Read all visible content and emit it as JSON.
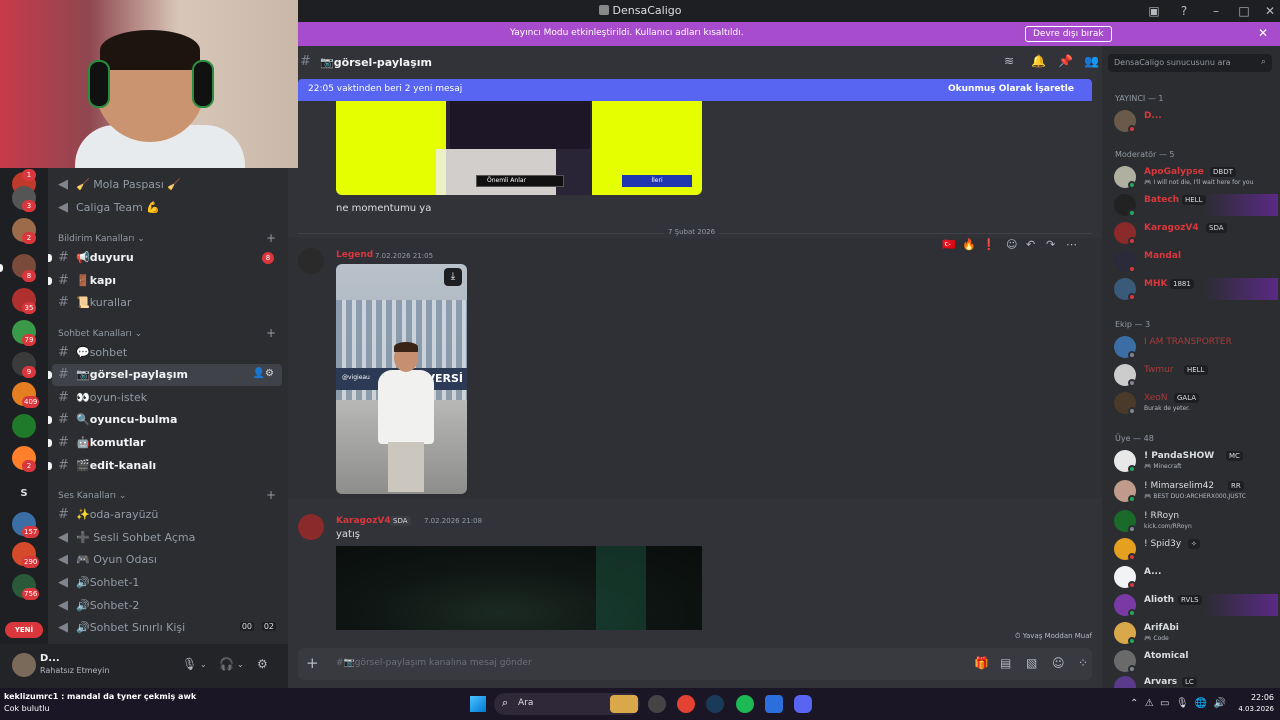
{
  "window": {
    "title": "DensaCaligo"
  },
  "banner": {
    "text": "Yayıncı Modu etkinleştirildi. Kullanıcı adları kısaltıldı.",
    "button": "Devre dışı bırak"
  },
  "server_rail": {
    "badges": [
      "1",
      "3",
      "2",
      "8",
      "35",
      "79",
      "9",
      "409",
      "2",
      "157",
      "290",
      "756"
    ],
    "server_letter": "S",
    "new_label": "YENİ",
    "colors": [
      "#c0392b",
      "#555555",
      "#9b6b4a",
      "#7a4a3a",
      "#b03030",
      "#3a9a4a",
      "#3b3b3b",
      "#e57e20",
      "#1f7a2a",
      "#ff7f2a",
      "#3a6ea5",
      "#d44a2a",
      "#2a5a3a",
      "#8a2a2a",
      "#d9a84a"
    ]
  },
  "channels": {
    "top": [
      {
        "name": "🧹 Mola Paspası 🧹",
        "icon": "speaker-icon"
      },
      {
        "name": "Caliga Team 💪",
        "icon": "speaker-icon"
      }
    ],
    "categories": [
      {
        "label": "Bildirim Kanalları"
      },
      {
        "label": "Sohbet Kanalları"
      },
      {
        "label": "Ses Kanalları"
      }
    ],
    "announce": [
      {
        "name": "📢duyuru",
        "badge": "8"
      },
      {
        "name": "🚪kapı"
      },
      {
        "name": "📜kurallar"
      }
    ],
    "chat": [
      {
        "name": "💬sohbet"
      },
      {
        "name": "📷görsel-paylaşım"
      },
      {
        "name": "👀oyun-istek"
      },
      {
        "name": "🔍oyuncu-bulma"
      },
      {
        "name": "🤖komutlar"
      },
      {
        "name": "🎬edit-kanalı"
      }
    ],
    "voice": [
      {
        "name": "✨oda-arayüzü"
      },
      {
        "name": "➕ Sesli Sohbet Açma"
      },
      {
        "name": "🎮 Oyun Odası"
      },
      {
        "name": "🔊Sohbet-1"
      },
      {
        "name": "🔊Sohbet-2"
      },
      {
        "name": "🔊Sohbet Sınırlı Kişi",
        "tag1": "00",
        "tag2": "02"
      }
    ]
  },
  "user_panel": {
    "name": "D...",
    "status": "Rahatsız Etmeyin"
  },
  "chat": {
    "channel": "📷görsel-paylaşım",
    "new_messages": "22:05 vaktinden beri 2 yeni mesaj",
    "mark_read": "Okunmuş Olarak İşaretle",
    "msg1": "ne momentumu ya",
    "date_divider": "7 Şubat 2026",
    "post2": {
      "author": "Legend",
      "timestamp": "7.02.2026 21:05",
      "author_color": "#da373c",
      "sign_text": "VERSİ",
      "watermark": "@vigieau"
    },
    "post3": {
      "author": "KaragozV4",
      "tag": "SDA",
      "timestamp": "7.02.2026 21:08",
      "text": "yatış",
      "author_color": "#da373c"
    },
    "img1": {
      "btn1": "Önemli Anlar",
      "btn2": "İleri"
    },
    "slow_mode": "Yavaş Moddan Muaf",
    "composer_placeholder": "#📷görsel-paylaşım kanalına mesaj gönder",
    "search_placeholder": "DensaCaligo sunucusunu ara"
  },
  "members": {
    "groups": [
      {
        "label": "YAYINCI — 1"
      },
      {
        "label": "Moderatör — 5"
      },
      {
        "label": "Ekip — 3"
      },
      {
        "label": "Üye — 48"
      }
    ],
    "list": [
      {
        "name": "D...",
        "color": "#da373c",
        "status": "#da373c",
        "avatar": "#6a5a4a"
      },
      {
        "name": "ApoGalypse",
        "tag": "DBDT",
        "sub": "🎮 I will not die, I'll wait here for you",
        "color": "#da373c",
        "status": "#23a55a",
        "avatar": "#b0b0a0"
      },
      {
        "name": "Batech",
        "tag": "HELL",
        "color": "#da373c",
        "status": "#23a55a",
        "avatar": "#222222"
      },
      {
        "name": "KaragozV4",
        "tag": "SDA",
        "color": "#da373c",
        "status": "#da373c",
        "avatar": "#8a2a2a"
      },
      {
        "name": "Mandal",
        "color": "#da373c",
        "status": "#da373c",
        "avatar": "#2a2a3a"
      },
      {
        "name": "MHK",
        "tag": "1881",
        "color": "#da373c",
        "status": "#da373c",
        "avatar": "#3a5a7a"
      },
      {
        "name": "I AM TRANSPORTER",
        "color": "#a83a3a",
        "status": "#80848e",
        "avatar": "#3a6ea5"
      },
      {
        "name": "Twmur",
        "tag": "HELL",
        "color": "#a83a3a",
        "status": "#80848e",
        "avatar": "#cccccc"
      },
      {
        "name": "XeoN",
        "tag": "GALA",
        "sub": "Burak de yeter.",
        "color": "#a83a3a",
        "status": "#80848e",
        "avatar": "#4a3a2a"
      },
      {
        "name": "! PandaSHOW",
        "tag": "MC",
        "sub": "🎮 Minecraft",
        "color": "#dbdee1",
        "status": "#23a55a",
        "avatar": "#e8e8e8"
      },
      {
        "name": "! Mimarselim42",
        "tag": "RR",
        "sub": "🎮 BEST DUO:ARCHERX000,JUSTC",
        "color": "#dbdee1",
        "status": "#23a55a",
        "avatar": "#c09a8a"
      },
      {
        "name": "! RRoyn",
        "sub": "kick.com/RRoyn",
        "color": "#dbdee1",
        "status": "#80848e",
        "avatar": "#1a6a2a"
      },
      {
        "name": "! Spid3y",
        "tag": "✧",
        "color": "#dbdee1",
        "status": "#da373c",
        "avatar": "#e5a020"
      },
      {
        "name": "A...",
        "color": "#dbdee1",
        "status": "#da373c",
        "avatar": "#f2f3f5"
      },
      {
        "name": "Alioth",
        "tag": "RVLS",
        "color": "#dbdee1",
        "status": "#23a55a",
        "avatar": "#7a3aa5"
      },
      {
        "name": "ArifAbi",
        "sub": "🎮 Code",
        "color": "#dbdee1",
        "status": "#23a55a",
        "avatar": "#d9a84a"
      },
      {
        "name": "Atomical",
        "color": "#dbdee1",
        "status": "#80848e",
        "avatar": "#6a6a6a"
      },
      {
        "name": "Arvars",
        "tag": "LC",
        "color": "#dbdee1",
        "status": "#80848e",
        "avatar": "#5a3a8a"
      }
    ]
  },
  "taskbar": {
    "chat_line1": "keklizumrc1 : mandal da tyner çekmiş awk",
    "chat_line2": "Cok bulutlu",
    "search": "Ara",
    "time": "22:06",
    "date": "4.03.2026",
    "app_colors": [
      "#d9a84a",
      "#444444",
      "#e34133",
      "#1a3a5a",
      "#1db954",
      "#2a6fdb",
      "#5865f2"
    ]
  }
}
